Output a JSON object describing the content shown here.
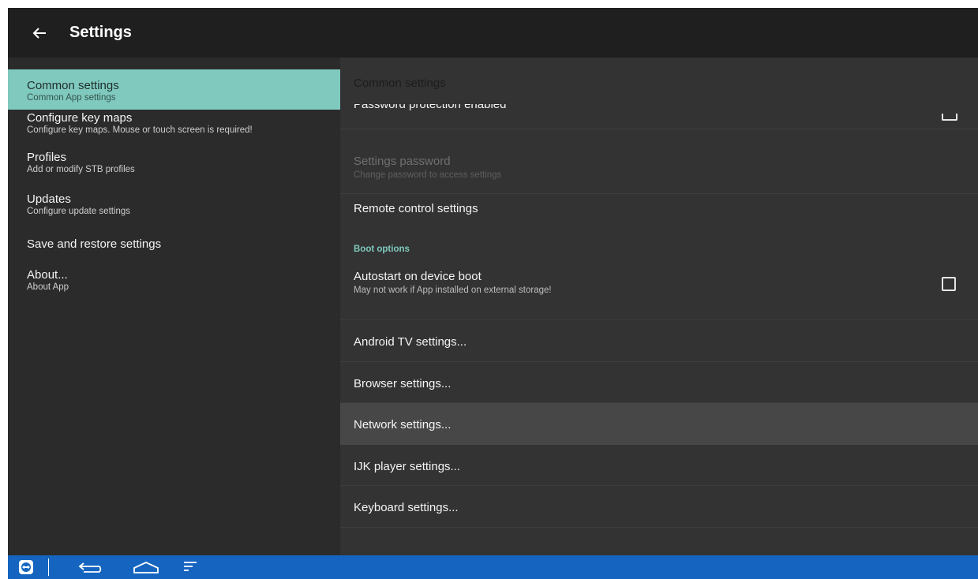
{
  "appbar": {
    "title": "Settings",
    "back_icon": "arrow-left-icon"
  },
  "sidebar": {
    "items": [
      {
        "title": "Common settings",
        "subtitle": "Common App settings",
        "active": true
      },
      {
        "title": "Configure key maps",
        "subtitle": "Configure key maps. Mouse or touch screen is required!"
      },
      {
        "title": "Profiles",
        "subtitle": "Add or modify STB profiles"
      },
      {
        "title": "Updates",
        "subtitle": "Configure update settings"
      },
      {
        "title": "Save and restore settings",
        "subtitle": ""
      },
      {
        "title": "About...",
        "subtitle": "About App"
      }
    ]
  },
  "main": {
    "title": "Common settings",
    "clipped_row_title": "Password protection enabled",
    "rows": {
      "settings_password": {
        "title": "Settings password",
        "subtitle": "Change password to access settings",
        "disabled": true
      },
      "remote_control": {
        "title": "Remote control settings"
      },
      "boot_category": "Boot options",
      "autostart": {
        "title": "Autostart on device boot",
        "subtitle": "May not work if App installed on external storage!",
        "checked": false
      },
      "android_tv": {
        "title": "Android TV settings..."
      },
      "browser": {
        "title": "Browser settings..."
      },
      "network": {
        "title": "Network settings...",
        "highlighted": true
      },
      "ijk_player": {
        "title": "IJK player settings..."
      },
      "keyboard": {
        "title": "Keyboard settings..."
      }
    }
  },
  "system_nav": {
    "icons": [
      "teamviewer-icon",
      "back-icon",
      "home-icon",
      "recent-apps-icon"
    ]
  },
  "colors": {
    "accent": "#7fc9be",
    "appbar": "#1f1f1f",
    "navbar": "#1565c0",
    "highlight_row": "#474747"
  }
}
